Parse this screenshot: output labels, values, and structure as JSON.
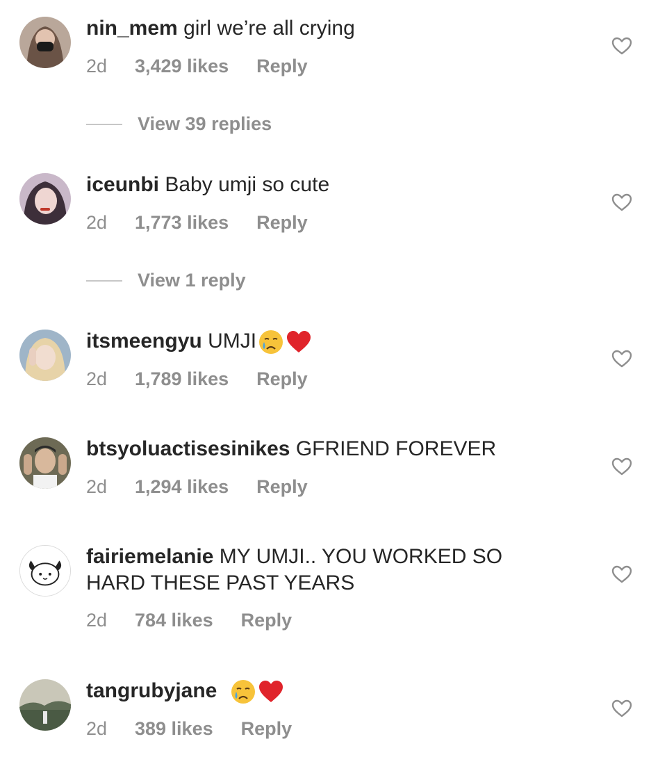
{
  "comments": [
    {
      "username": "nin_mem",
      "text": "girl we’re all crying",
      "time": "2d",
      "likes": "3,429 likes",
      "reply": "Reply",
      "replies_label": "View 39 replies"
    },
    {
      "username": "iceunbi",
      "text": "Baby umji so cute",
      "time": "2d",
      "likes": "1,773 likes",
      "reply": "Reply",
      "replies_label": "View 1 reply"
    },
    {
      "username": "itsmeengyu",
      "text": "UMJI",
      "emojis": [
        "crying-face",
        "red-heart"
      ],
      "time": "2d",
      "likes": "1,789 likes",
      "reply": "Reply"
    },
    {
      "username": "btsyoluactisesinikes",
      "text": "GFRIEND FOREVER",
      "time": "2d",
      "likes": "1,294 likes",
      "reply": "Reply"
    },
    {
      "username": "fairiemelanie",
      "text": "MY UMJI.. YOU WORKED SO HARD THESE PAST YEARS",
      "time": "2d",
      "likes": "784 likes",
      "reply": "Reply"
    },
    {
      "username": "tangrubyjane",
      "text": "",
      "emojis": [
        "crying-face",
        "red-heart"
      ],
      "time": "2d",
      "likes": "389 likes",
      "reply": "Reply"
    }
  ],
  "colors": {
    "text": "#262626",
    "muted": "#8e8e8e",
    "heart_emoji": "#e0242b"
  },
  "icons": {
    "like": "heart-outline-icon"
  }
}
